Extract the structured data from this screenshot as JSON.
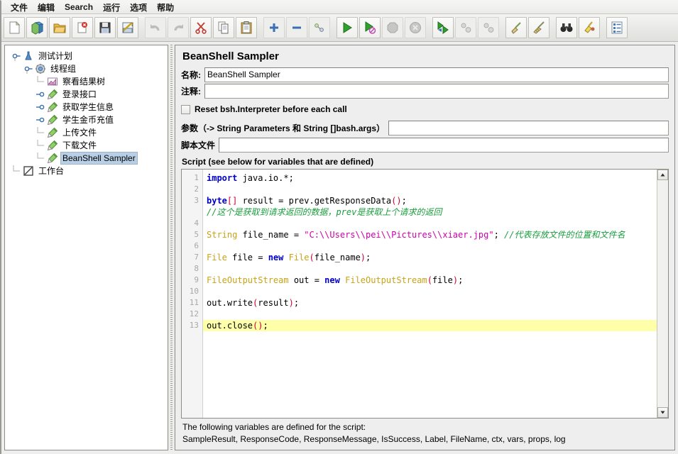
{
  "menu": {
    "items": [
      {
        "label": "文件",
        "name": "menu-file"
      },
      {
        "label": "编辑",
        "name": "menu-edit"
      },
      {
        "label": "Search",
        "name": "menu-search"
      },
      {
        "label": "运行",
        "name": "menu-run"
      },
      {
        "label": "选项",
        "name": "menu-options"
      },
      {
        "label": "帮助",
        "name": "menu-help"
      }
    ]
  },
  "toolbar": {
    "buttons": [
      {
        "name": "new-button",
        "icon": "new-file-icon"
      },
      {
        "name": "templates-button",
        "icon": "templates-icon"
      },
      {
        "name": "open-button",
        "icon": "open-folder-icon"
      },
      {
        "name": "close-button",
        "icon": "close-file-icon"
      },
      {
        "name": "save-button",
        "icon": "save-disk-icon"
      },
      {
        "name": "save-as-button",
        "icon": "save-as-icon"
      },
      {
        "name": "undo-button",
        "icon": "undo-arrow-icon"
      },
      {
        "name": "redo-button",
        "icon": "redo-arrow-icon"
      },
      {
        "name": "cut-button",
        "icon": "scissors-icon"
      },
      {
        "name": "copy-button",
        "icon": "copy-pages-icon"
      },
      {
        "name": "paste-button",
        "icon": "clipboard-icon"
      },
      {
        "name": "expand-all-button",
        "icon": "plus-icon"
      },
      {
        "name": "collapse-all-button",
        "icon": "minus-icon"
      },
      {
        "name": "toggle-button",
        "icon": "toggle-node-icon"
      },
      {
        "name": "start-button",
        "icon": "play-green-icon"
      },
      {
        "name": "start-no-pauses-button",
        "icon": "play-no-pause-icon"
      },
      {
        "name": "stop-button",
        "icon": "stop-octagon-icon"
      },
      {
        "name": "shutdown-button",
        "icon": "shutdown-circle-icon"
      },
      {
        "name": "start-remote-button",
        "icon": "remote-start-icon"
      },
      {
        "name": "stop-remote-button",
        "icon": "remote-stop-icon"
      },
      {
        "name": "shutdown-remote-button",
        "icon": "remote-shutdown-icon"
      },
      {
        "name": "clear-button",
        "icon": "broom-clear-icon"
      },
      {
        "name": "clear-all-button",
        "icon": "broom-clear-all-icon"
      },
      {
        "name": "search-button",
        "icon": "binoculars-icon"
      },
      {
        "name": "reset-search-button",
        "icon": "broom-reset-icon"
      },
      {
        "name": "function-helper-button",
        "icon": "function-helper-icon"
      }
    ]
  },
  "tree": {
    "nodes": [
      {
        "label": "测试计划",
        "name": "tree-node-test-plan",
        "depth": 0,
        "icon": "test-plan-icon",
        "handle": "expanded",
        "selected": false
      },
      {
        "label": "线程组",
        "name": "tree-node-thread-group",
        "depth": 1,
        "icon": "thread-group-icon",
        "handle": "expanded",
        "selected": false
      },
      {
        "label": "察看结果树",
        "name": "tree-node-view-results-tree",
        "depth": 2,
        "icon": "view-results-tree-icon",
        "handle": "leaf",
        "selected": false
      },
      {
        "label": "登录接口",
        "name": "tree-node-login-api",
        "depth": 2,
        "icon": "sampler-icon",
        "handle": "collapsed",
        "selected": false
      },
      {
        "label": "获取学生信息",
        "name": "tree-node-get-student-info",
        "depth": 2,
        "icon": "sampler-icon",
        "handle": "collapsed",
        "selected": false
      },
      {
        "label": "学生金币充值",
        "name": "tree-node-student-coin-recharge",
        "depth": 2,
        "icon": "sampler-icon",
        "handle": "collapsed",
        "selected": false
      },
      {
        "label": "上传文件",
        "name": "tree-node-upload-file",
        "depth": 2,
        "icon": "sampler-icon",
        "handle": "leaf",
        "selected": false
      },
      {
        "label": "下载文件",
        "name": "tree-node-download-file",
        "depth": 2,
        "icon": "sampler-icon",
        "handle": "leaf",
        "selected": false
      },
      {
        "label": "BeanShell Sampler",
        "name": "tree-node-beanshell-sampler",
        "depth": 2,
        "icon": "sampler-icon",
        "handle": "leaf",
        "selected": true
      },
      {
        "label": "工作台",
        "name": "tree-node-workbench",
        "depth": 0,
        "icon": "workbench-icon",
        "handle": "leaf",
        "selected": false
      }
    ]
  },
  "panel": {
    "title": "BeanShell Sampler",
    "name_label": "名称:",
    "name_value": "BeanShell Sampler",
    "comment_label": "注释:",
    "comment_value": "",
    "reset_checkbox_label": "Reset bsh.Interpreter before each call",
    "reset_checkbox_checked": false,
    "parameters_label": "参数（-> String Parameters 和 String []bash.args）",
    "parameters_value": "",
    "script_file_label": "脚本文件",
    "script_file_value": "",
    "script_section_label": "Script (see below for variables that are defined)"
  },
  "editor": {
    "current_line": 13,
    "line_numbers": [
      1,
      2,
      3,
      4,
      5,
      6,
      7,
      8,
      9,
      10,
      11,
      12,
      13
    ],
    "lines": [
      {
        "n": 1,
        "tokens": [
          {
            "t": "import",
            "c": "kw"
          },
          {
            "t": " java.io.*;",
            "c": "plain"
          }
        ]
      },
      {
        "n": 2,
        "tokens": []
      },
      {
        "n": 3,
        "tokens": [
          {
            "t": "byte",
            "c": "kw"
          },
          {
            "t": "[]",
            "c": "pun"
          },
          {
            "t": " result = prev.getResponseData",
            "c": "plain"
          },
          {
            "t": "()",
            "c": "pun"
          },
          {
            "t": ";",
            "c": "plain"
          }
        ]
      },
      {
        "n": null,
        "tokens": [
          {
            "t": "//这个是获取到请求返回的数据，prev是获取上个请求的返回",
            "c": "cmt"
          }
        ]
      },
      {
        "n": 4,
        "tokens": []
      },
      {
        "n": 5,
        "tokens": [
          {
            "t": "String",
            "c": "typ"
          },
          {
            "t": " file_name = ",
            "c": "plain"
          },
          {
            "t": "\"C:\\\\Users\\\\pei\\\\Pictures\\\\xiaer.jpg\"",
            "c": "str"
          },
          {
            "t": "; ",
            "c": "plain"
          },
          {
            "t": "//代表存放文件的位置和文件名",
            "c": "cmt"
          }
        ]
      },
      {
        "n": 6,
        "tokens": []
      },
      {
        "n": 7,
        "tokens": [
          {
            "t": "File",
            "c": "typ"
          },
          {
            "t": " file = ",
            "c": "plain"
          },
          {
            "t": "new",
            "c": "kw"
          },
          {
            "t": " ",
            "c": "plain"
          },
          {
            "t": "File",
            "c": "typ"
          },
          {
            "t": "(",
            "c": "pun"
          },
          {
            "t": "file_name",
            "c": "plain"
          },
          {
            "t": ")",
            "c": "pun"
          },
          {
            "t": ";",
            "c": "plain"
          }
        ]
      },
      {
        "n": 8,
        "tokens": []
      },
      {
        "n": 9,
        "tokens": [
          {
            "t": "FileOutputStream",
            "c": "typ"
          },
          {
            "t": " out = ",
            "c": "plain"
          },
          {
            "t": "new",
            "c": "kw"
          },
          {
            "t": " ",
            "c": "plain"
          },
          {
            "t": "FileOutputStream",
            "c": "typ"
          },
          {
            "t": "(",
            "c": "pun"
          },
          {
            "t": "file",
            "c": "plain"
          },
          {
            "t": ")",
            "c": "pun"
          },
          {
            "t": ";",
            "c": "plain"
          }
        ]
      },
      {
        "n": 10,
        "tokens": []
      },
      {
        "n": 11,
        "tokens": [
          {
            "t": "out.write",
            "c": "plain"
          },
          {
            "t": "(",
            "c": "pun"
          },
          {
            "t": "result",
            "c": "plain"
          },
          {
            "t": ")",
            "c": "pun"
          },
          {
            "t": ";",
            "c": "plain"
          }
        ]
      },
      {
        "n": 12,
        "tokens": []
      },
      {
        "n": 13,
        "tokens": [
          {
            "t": "out.close",
            "c": "plain"
          },
          {
            "t": "()",
            "c": "pun"
          },
          {
            "t": ";",
            "c": "plain"
          }
        ],
        "current": true
      }
    ]
  },
  "footer": {
    "line1": "The following variables are defined for the script:",
    "line2": "SampleResult, ResponseCode, ResponseMessage, IsSuccess, Label, FileName, ctx, vars, props, log"
  },
  "colors": {
    "selection": "#b8cfe5",
    "current_line": "#ffffaa",
    "keyword": "#0000cc",
    "type": "#c8a317",
    "string": "#cc00aa",
    "comment": "#1a9e3e",
    "punctuation": "#cc0033"
  }
}
